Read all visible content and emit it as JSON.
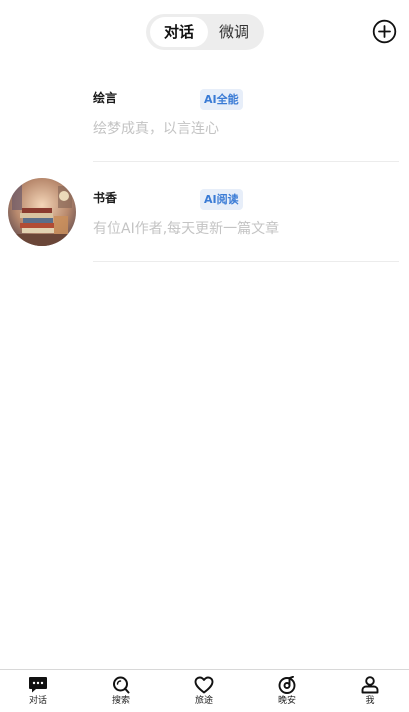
{
  "header": {
    "tabs": [
      {
        "label": "对话",
        "active": true
      },
      {
        "label": "微调",
        "active": false
      }
    ],
    "add_icon": "plus-circle-icon"
  },
  "conversations": [
    {
      "name": "绘言",
      "badge": "AI全能",
      "description": "绘梦成真，以言连心",
      "has_avatar": false
    },
    {
      "name": "书香",
      "badge": "AI阅读",
      "description": "有位AI作者,每天更新一篇文章",
      "has_avatar": true,
      "avatar_icon": "bookshelf-illustration"
    }
  ],
  "bottom_nav": [
    {
      "label": "对话",
      "icon": "chat-bubble-icon",
      "active": true
    },
    {
      "label": "搜索",
      "icon": "search-icon",
      "active": false
    },
    {
      "label": "旅途",
      "icon": "heart-icon",
      "active": false
    },
    {
      "label": "晚安",
      "icon": "music-disc-icon",
      "active": false
    },
    {
      "label": "我",
      "icon": "person-icon",
      "active": false
    }
  ],
  "colors": {
    "badge_text": "#3a7bd5",
    "badge_bg": "#e7eef9",
    "muted_text": "#c4c4c4",
    "segment_bg": "#ededed"
  }
}
